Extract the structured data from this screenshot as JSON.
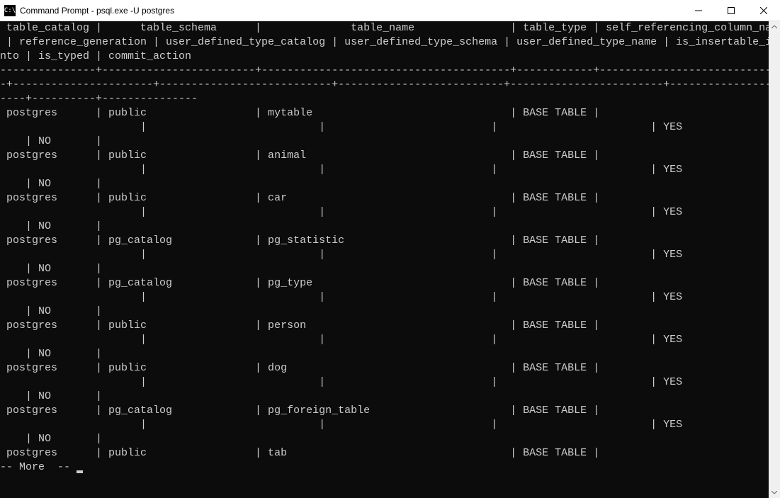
{
  "window": {
    "title": "Command Prompt - psql.exe  -U postgres",
    "icon_label": "C:\\"
  },
  "terminal": {
    "header_line1": " table_catalog |      table_schema      |              table_name               | table_type | self_referencing_column_name",
    "header_line2": " | reference_generation | user_defined_type_catalog | user_defined_type_schema | user_defined_type_name | is_insertable_i",
    "header_line3": "nto | is_typed | commit_action",
    "separator1": "---------------+------------------------+---------------------------------------+------------+-----------------------------",
    "separator2": "-+----------------------+---------------------------+--------------------------+------------------------+----------------",
    "separator3": "----+----------+---------------",
    "more_prompt": "-- More  -- ",
    "columns_meta": [
      "table_catalog",
      "table_schema",
      "table_name",
      "table_type",
      "self_referencing_column_name",
      "reference_generation",
      "user_defined_type_catalog",
      "user_defined_type_schema",
      "user_defined_type_name",
      "is_insertable_into",
      "is_typed",
      "commit_action"
    ],
    "rows": [
      {
        "catalog": "postgres",
        "schema": "public",
        "name": "mytable",
        "type": "BASE TABLE",
        "insertable": "YES",
        "typed": "NO"
      },
      {
        "catalog": "postgres",
        "schema": "public",
        "name": "animal",
        "type": "BASE TABLE",
        "insertable": "YES",
        "typed": "NO"
      },
      {
        "catalog": "postgres",
        "schema": "public",
        "name": "car",
        "type": "BASE TABLE",
        "insertable": "YES",
        "typed": "NO"
      },
      {
        "catalog": "postgres",
        "schema": "pg_catalog",
        "name": "pg_statistic",
        "type": "BASE TABLE",
        "insertable": "YES",
        "typed": "NO"
      },
      {
        "catalog": "postgres",
        "schema": "pg_catalog",
        "name": "pg_type",
        "type": "BASE TABLE",
        "insertable": "YES",
        "typed": "NO"
      },
      {
        "catalog": "postgres",
        "schema": "public",
        "name": "person",
        "type": "BASE TABLE",
        "insertable": "YES",
        "typed": "NO"
      },
      {
        "catalog": "postgres",
        "schema": "public",
        "name": "dog",
        "type": "BASE TABLE",
        "insertable": "YES",
        "typed": "NO"
      },
      {
        "catalog": "postgres",
        "schema": "pg_catalog",
        "name": "pg_foreign_table",
        "type": "BASE TABLE",
        "insertable": "YES",
        "typed": "NO"
      },
      {
        "catalog": "postgres",
        "schema": "public",
        "name": "tab",
        "type": "BASE TABLE",
        "insertable": null,
        "typed": null
      }
    ]
  }
}
